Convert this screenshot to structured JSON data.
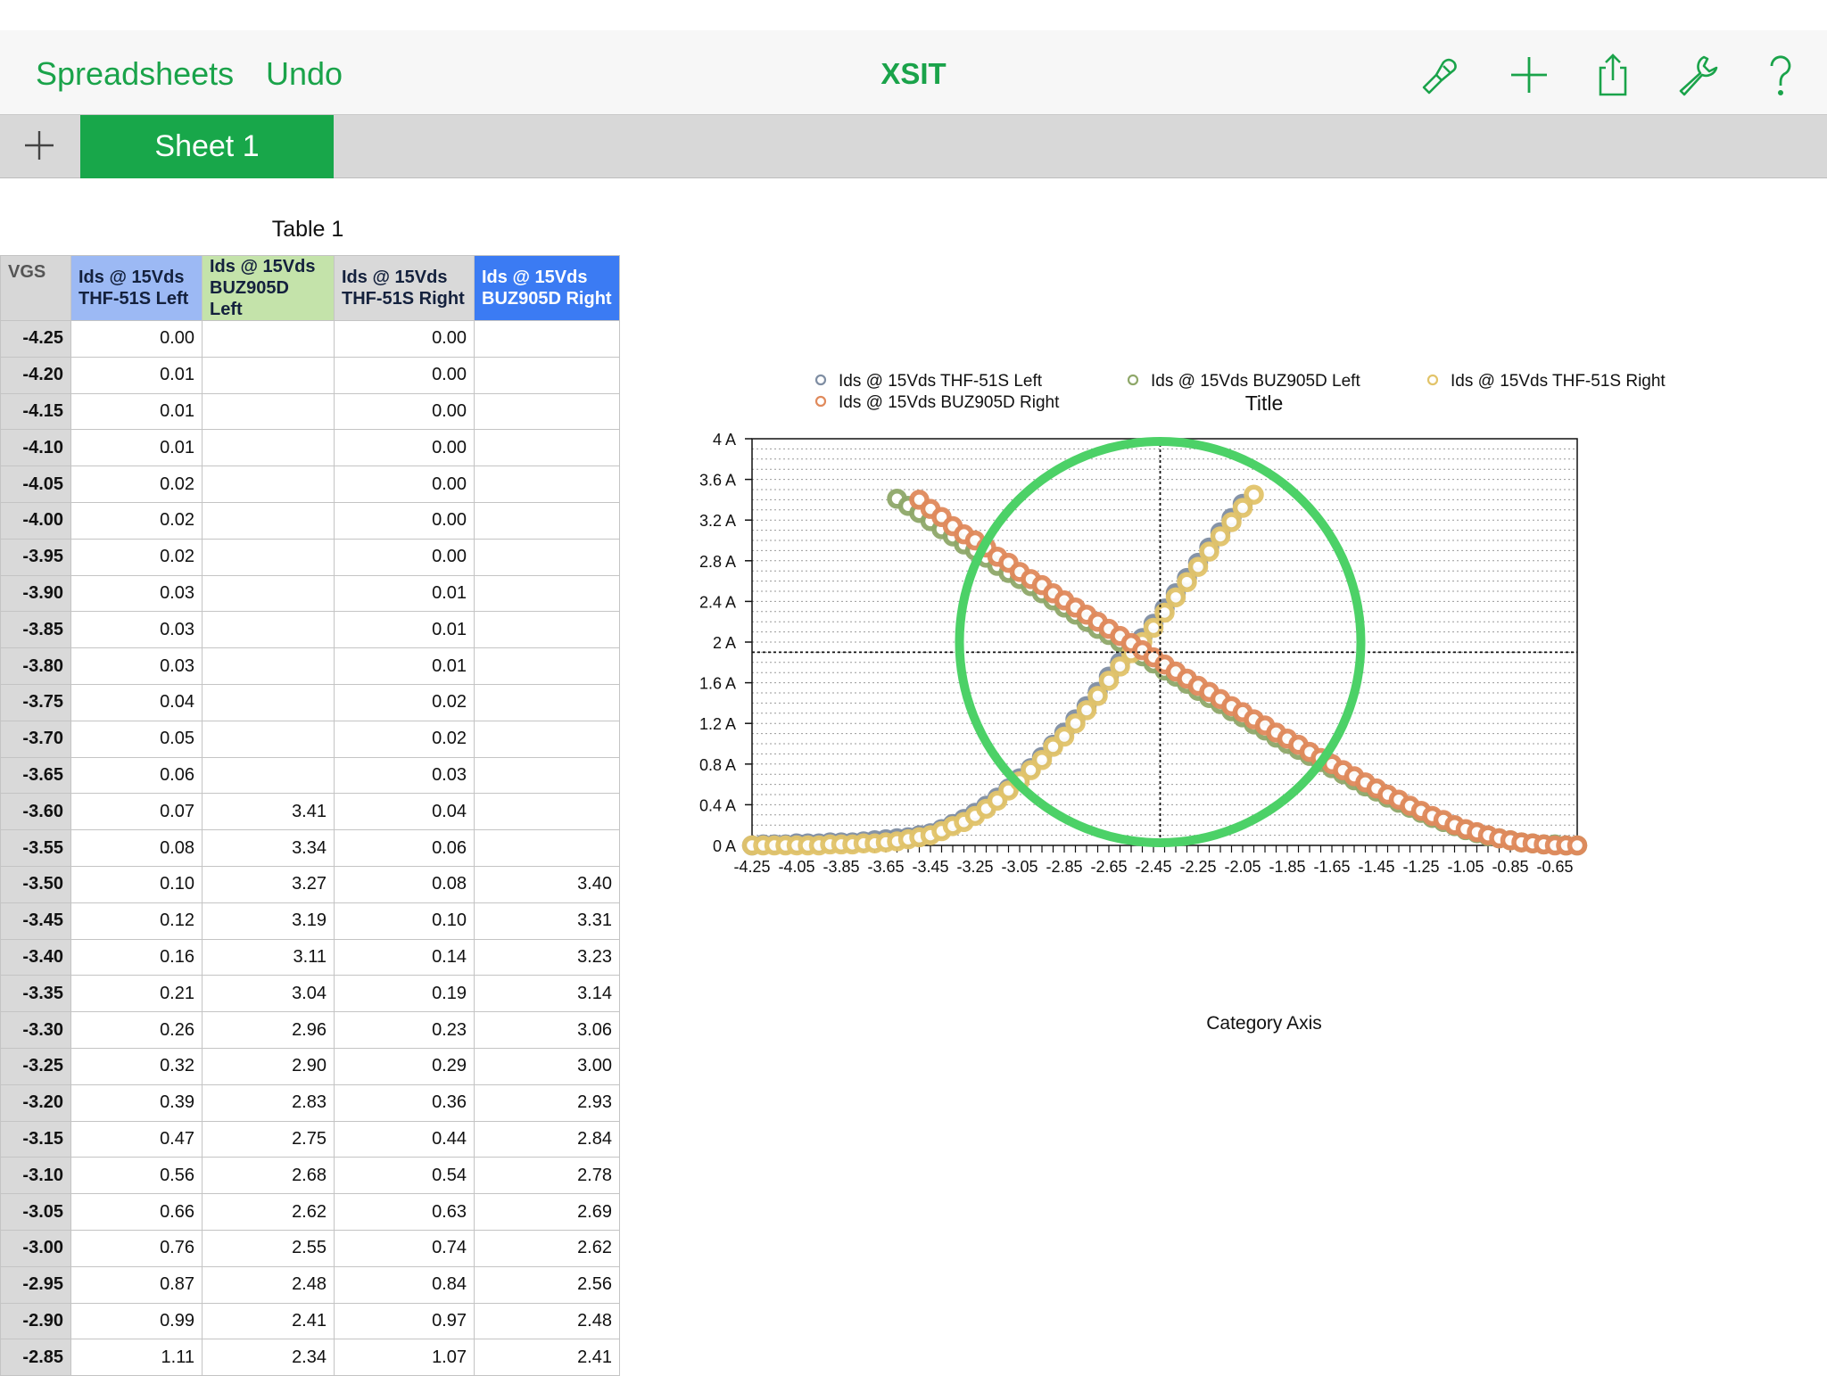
{
  "toolbar": {
    "spreadsheets_label": "Spreadsheets",
    "undo_label": "Undo",
    "title": "XSIT",
    "icons": [
      "paintbrush-icon",
      "plus-icon",
      "share-icon",
      "wrench-icon",
      "help-icon"
    ],
    "accent_color": "#1aa34a"
  },
  "tabs": {
    "add_icon": "plus-icon",
    "sheets": [
      {
        "label": "Sheet 1",
        "active": true
      }
    ],
    "active_color": "#18a74a"
  },
  "table": {
    "title": "Table 1",
    "columns": [
      {
        "line1": "VGS",
        "line2": ""
      },
      {
        "line1": "Ids @ 15Vds",
        "line2": "THF-51S Left"
      },
      {
        "line1": "Ids @ 15Vds",
        "line2": "BUZ905D Left"
      },
      {
        "line1": "Ids @ 15Vds",
        "line2": "THF-51S Right"
      },
      {
        "line1": "Ids @ 15Vds",
        "line2": "BUZ905D Right"
      }
    ],
    "rows": [
      [
        "-4.25",
        "0.00",
        "",
        "0.00",
        ""
      ],
      [
        "-4.20",
        "0.01",
        "",
        "0.00",
        ""
      ],
      [
        "-4.15",
        "0.01",
        "",
        "0.00",
        ""
      ],
      [
        "-4.10",
        "0.01",
        "",
        "0.00",
        ""
      ],
      [
        "-4.05",
        "0.02",
        "",
        "0.00",
        ""
      ],
      [
        "-4.00",
        "0.02",
        "",
        "0.00",
        ""
      ],
      [
        "-3.95",
        "0.02",
        "",
        "0.00",
        ""
      ],
      [
        "-3.90",
        "0.03",
        "",
        "0.01",
        ""
      ],
      [
        "-3.85",
        "0.03",
        "",
        "0.01",
        ""
      ],
      [
        "-3.80",
        "0.03",
        "",
        "0.01",
        ""
      ],
      [
        "-3.75",
        "0.04",
        "",
        "0.02",
        ""
      ],
      [
        "-3.70",
        "0.05",
        "",
        "0.02",
        ""
      ],
      [
        "-3.65",
        "0.06",
        "",
        "0.03",
        ""
      ],
      [
        "-3.60",
        "0.07",
        "3.41",
        "0.04",
        ""
      ],
      [
        "-3.55",
        "0.08",
        "3.34",
        "0.06",
        ""
      ],
      [
        "-3.50",
        "0.10",
        "3.27",
        "0.08",
        "3.40"
      ],
      [
        "-3.45",
        "0.12",
        "3.19",
        "0.10",
        "3.31"
      ],
      [
        "-3.40",
        "0.16",
        "3.11",
        "0.14",
        "3.23"
      ],
      [
        "-3.35",
        "0.21",
        "3.04",
        "0.19",
        "3.14"
      ],
      [
        "-3.30",
        "0.26",
        "2.96",
        "0.23",
        "3.06"
      ],
      [
        "-3.25",
        "0.32",
        "2.90",
        "0.29",
        "3.00"
      ],
      [
        "-3.20",
        "0.39",
        "2.83",
        "0.36",
        "2.93"
      ],
      [
        "-3.15",
        "0.47",
        "2.75",
        "0.44",
        "2.84"
      ],
      [
        "-3.10",
        "0.56",
        "2.68",
        "0.54",
        "2.78"
      ],
      [
        "-3.05",
        "0.66",
        "2.62",
        "0.63",
        "2.69"
      ],
      [
        "-3.00",
        "0.76",
        "2.55",
        "0.74",
        "2.62"
      ],
      [
        "-2.95",
        "0.87",
        "2.48",
        "0.84",
        "2.56"
      ],
      [
        "-2.90",
        "0.99",
        "2.41",
        "0.97",
        "2.48"
      ],
      [
        "-2.85",
        "1.11",
        "2.34",
        "1.07",
        "2.41"
      ]
    ]
  },
  "chart_data": {
    "type": "scatter",
    "title": "Title",
    "xlabel": "Category Axis",
    "ylabel": "",
    "xlim": [
      -4.25,
      -0.55
    ],
    "ylim": [
      0,
      4
    ],
    "x_tick_labels": [
      "-4.25",
      "-4.05",
      "-3.85",
      "-3.65",
      "-3.45",
      "-3.25",
      "-3.05",
      "-2.85",
      "-2.65",
      "-2.45",
      "-2.25",
      "-2.05",
      "-1.85",
      "-1.65",
      "-1.45",
      "-1.25",
      "-1.05",
      "-0.85",
      "-0.65"
    ],
    "y_ticks": [
      0,
      0.4,
      0.8,
      1.2,
      1.6,
      2,
      2.4,
      2.8,
      3.2,
      3.6,
      4
    ],
    "y_tick_labels": [
      "0 A",
      "0.4 A",
      "0.8 A",
      "1.2 A",
      "1.6 A",
      "2 A",
      "2.4 A",
      "2.8 A",
      "3.2 A",
      "3.6 A",
      "4 A"
    ],
    "grid": true,
    "legend_position": "top",
    "series": [
      {
        "name": "Ids @ 15Vds  THF-51S Left",
        "color": "#7f8ea3",
        "x": [
          -4.25,
          -4.2,
          -4.15,
          -4.1,
          -4.05,
          -4.0,
          -3.95,
          -3.9,
          -3.85,
          -3.8,
          -3.75,
          -3.7,
          -3.65,
          -3.6,
          -3.55,
          -3.5,
          -3.45,
          -3.4,
          -3.35,
          -3.3,
          -3.25,
          -3.2,
          -3.15,
          -3.1,
          -3.05,
          -3.0,
          -2.95,
          -2.9,
          -2.85,
          -2.8,
          -2.75,
          -2.7,
          -2.65,
          -2.6,
          -2.55,
          -2.5,
          -2.45,
          -2.4,
          -2.35,
          -2.3,
          -2.25,
          -2.2,
          -2.15,
          -2.1,
          -2.05
        ],
        "y": [
          0.0,
          0.01,
          0.01,
          0.01,
          0.02,
          0.02,
          0.02,
          0.03,
          0.03,
          0.03,
          0.04,
          0.05,
          0.06,
          0.07,
          0.08,
          0.1,
          0.12,
          0.16,
          0.21,
          0.26,
          0.32,
          0.39,
          0.47,
          0.56,
          0.66,
          0.76,
          0.87,
          0.99,
          1.11,
          1.24,
          1.37,
          1.51,
          1.66,
          1.8,
          1.92,
          2.04,
          2.18,
          2.33,
          2.48,
          2.63,
          2.78,
          2.93,
          3.08,
          3.22,
          3.36
        ]
      },
      {
        "name": "Ids @ 15Vds BUZ905D Left",
        "color": "#8fa86a",
        "x": [
          -3.6,
          -3.55,
          -3.5,
          -3.45,
          -3.4,
          -3.35,
          -3.3,
          -3.25,
          -3.2,
          -3.15,
          -3.1,
          -3.05,
          -3.0,
          -2.95,
          -2.9,
          -2.85,
          -2.8,
          -2.75,
          -2.7,
          -2.65,
          -2.6,
          -2.55,
          -2.5,
          -2.45,
          -2.4,
          -2.35,
          -2.3,
          -2.25,
          -2.2,
          -2.15,
          -2.1,
          -2.05,
          -2.0,
          -1.95,
          -1.9,
          -1.85,
          -1.8,
          -1.75,
          -1.7,
          -1.65,
          -1.6,
          -1.55,
          -1.5,
          -1.45,
          -1.4,
          -1.35,
          -1.3,
          -1.25,
          -1.2,
          -1.15,
          -1.1,
          -1.05,
          -1.0,
          -0.95,
          -0.9,
          -0.85,
          -0.8,
          -0.75,
          -0.7,
          -0.65,
          -0.6,
          -0.55
        ],
        "y": [
          3.41,
          3.34,
          3.27,
          3.19,
          3.11,
          3.04,
          2.96,
          2.9,
          2.83,
          2.75,
          2.68,
          2.62,
          2.55,
          2.48,
          2.41,
          2.34,
          2.27,
          2.2,
          2.13,
          2.07,
          2.0,
          1.93,
          1.86,
          1.79,
          1.72,
          1.66,
          1.59,
          1.52,
          1.45,
          1.39,
          1.32,
          1.26,
          1.19,
          1.13,
          1.06,
          1.0,
          0.94,
          0.88,
          0.82,
          0.76,
          0.7,
          0.64,
          0.58,
          0.53,
          0.47,
          0.42,
          0.37,
          0.32,
          0.27,
          0.23,
          0.19,
          0.15,
          0.12,
          0.09,
          0.07,
          0.05,
          0.03,
          0.02,
          0.01,
          0.01,
          0.0,
          0.0
        ]
      },
      {
        "name": "Ids @ 15Vds  THF-51S Right",
        "color": "#e2c46a",
        "x": [
          -4.25,
          -4.2,
          -4.15,
          -4.1,
          -4.05,
          -4.0,
          -3.95,
          -3.9,
          -3.85,
          -3.8,
          -3.75,
          -3.7,
          -3.65,
          -3.6,
          -3.55,
          -3.5,
          -3.45,
          -3.4,
          -3.35,
          -3.3,
          -3.25,
          -3.2,
          -3.15,
          -3.1,
          -3.05,
          -3.0,
          -2.95,
          -2.9,
          -2.85,
          -2.8,
          -2.75,
          -2.7,
          -2.65,
          -2.6,
          -2.55,
          -2.5,
          -2.45,
          -2.4,
          -2.35,
          -2.3,
          -2.25,
          -2.2,
          -2.15,
          -2.1,
          -2.05,
          -2.0
        ],
        "y": [
          0.0,
          0.0,
          0.0,
          0.0,
          0.0,
          0.0,
          0.0,
          0.01,
          0.01,
          0.01,
          0.02,
          0.02,
          0.03,
          0.04,
          0.06,
          0.08,
          0.1,
          0.14,
          0.19,
          0.23,
          0.29,
          0.36,
          0.44,
          0.54,
          0.63,
          0.74,
          0.84,
          0.97,
          1.07,
          1.2,
          1.33,
          1.47,
          1.62,
          1.76,
          1.89,
          2.0,
          2.14,
          2.29,
          2.44,
          2.59,
          2.74,
          2.89,
          3.04,
          3.18,
          3.32,
          3.45
        ]
      },
      {
        "name": "Ids @ 15Vds BUZ905D Right",
        "color": "#e08a5c",
        "x": [
          -3.5,
          -3.45,
          -3.4,
          -3.35,
          -3.3,
          -3.25,
          -3.2,
          -3.15,
          -3.1,
          -3.05,
          -3.0,
          -2.95,
          -2.9,
          -2.85,
          -2.8,
          -2.75,
          -2.7,
          -2.65,
          -2.6,
          -2.55,
          -2.5,
          -2.45,
          -2.4,
          -2.35,
          -2.3,
          -2.25,
          -2.2,
          -2.15,
          -2.1,
          -2.05,
          -2.0,
          -1.95,
          -1.9,
          -1.85,
          -1.8,
          -1.75,
          -1.7,
          -1.65,
          -1.6,
          -1.55,
          -1.5,
          -1.45,
          -1.4,
          -1.35,
          -1.3,
          -1.25,
          -1.2,
          -1.15,
          -1.1,
          -1.05,
          -1.0,
          -0.95,
          -0.9,
          -0.85,
          -0.8,
          -0.75,
          -0.7,
          -0.65,
          -0.6,
          -0.55
        ],
        "y": [
          3.4,
          3.31,
          3.23,
          3.14,
          3.06,
          3.0,
          2.93,
          2.84,
          2.78,
          2.69,
          2.62,
          2.56,
          2.48,
          2.41,
          2.34,
          2.27,
          2.2,
          2.13,
          2.06,
          1.99,
          1.92,
          1.85,
          1.78,
          1.71,
          1.64,
          1.57,
          1.51,
          1.44,
          1.37,
          1.31,
          1.24,
          1.18,
          1.11,
          1.05,
          0.99,
          0.92,
          0.86,
          0.8,
          0.74,
          0.68,
          0.62,
          0.56,
          0.5,
          0.45,
          0.39,
          0.34,
          0.29,
          0.25,
          0.2,
          0.16,
          0.13,
          0.1,
          0.07,
          0.05,
          0.03,
          0.02,
          0.01,
          0.0,
          0.0,
          0.0
        ]
      }
    ],
    "annotation": {
      "shape": "circle",
      "color": "#4cd167",
      "center": [
        -2.42,
        2.0
      ],
      "radius_x_units": 0.9
    },
    "crosshair": {
      "x": -2.42,
      "y": 1.9
    }
  }
}
